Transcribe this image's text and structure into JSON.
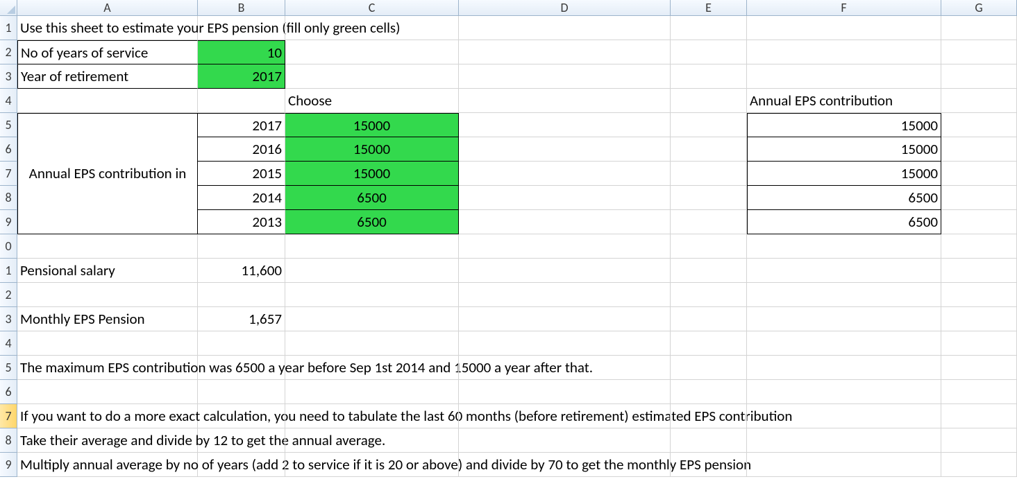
{
  "columns": [
    "A",
    "B",
    "C",
    "D",
    "E",
    "F",
    "G"
  ],
  "rowLabels": [
    "1",
    "2",
    "3",
    "4",
    "5",
    "6",
    "7",
    "8",
    "9",
    "0",
    "1",
    "2",
    "3",
    "4",
    "5",
    "6",
    "7",
    "8",
    "9"
  ],
  "selectedRow": 17,
  "r1": {
    "A": "Use this sheet to estimate your EPS pension (fill only green cells)"
  },
  "r2": {
    "A": "No of years of service",
    "B": "10"
  },
  "r3": {
    "A": "Year of retirement",
    "B": "2017"
  },
  "r4": {
    "C": "Choose",
    "F": "Annual EPS contribution"
  },
  "mergeA": "Annual EPS contribution in",
  "years": [
    {
      "B": "2017",
      "C": "15000",
      "F": "15000"
    },
    {
      "B": "2016",
      "C": "15000",
      "F": "15000"
    },
    {
      "B": "2015",
      "C": "15000",
      "F": "15000"
    },
    {
      "B": "2014",
      "C": "6500",
      "F": "6500"
    },
    {
      "B": "2013",
      "C": "6500",
      "F": "6500"
    }
  ],
  "r11": {
    "A": "Pensional salary",
    "B": "11,600"
  },
  "r13": {
    "A": "Monthly EPS Pension",
    "B": "1,657"
  },
  "r15": {
    "A": "The maximum EPS contribution was 6500 a year before Sep 1st 2014 and 15000 a year after that."
  },
  "r17": {
    "A": "If you want to do a more exact calculation, you need to tabulate the last 60 months (before retirement) estimated EPS contribution"
  },
  "r18": {
    "A": "Take their average and divide by 12 to get the annual average."
  },
  "r19": {
    "A": "Multiply annual average by no of years (add 2 to service if it is 20 or above) and divide by 70 to get the monthly EPS pension"
  }
}
